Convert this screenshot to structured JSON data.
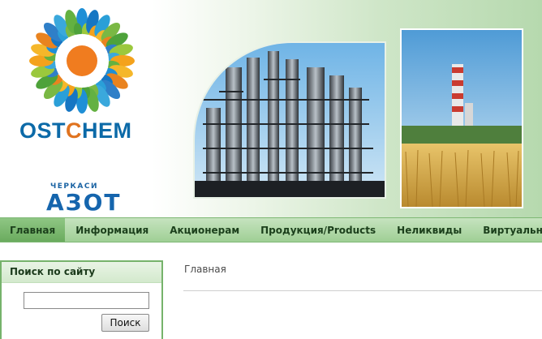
{
  "header": {
    "brand": {
      "prefix": "OST",
      "o": "C",
      "suffix": "HEM"
    },
    "sub_brand": {
      "small": "ЧЕРКАСИ",
      "big": "АЗОТ"
    }
  },
  "nav": {
    "items": [
      {
        "label": "Главная",
        "active": true
      },
      {
        "label": "Информация"
      },
      {
        "label": "Акционерам"
      },
      {
        "label": "Продукция/Products"
      },
      {
        "label": "Неликвиды"
      },
      {
        "label": "Виртуальная п"
      }
    ]
  },
  "search": {
    "title": "Поиск по сайту",
    "input_value": "",
    "button_label": "Поиск"
  },
  "main": {
    "breadcrumb": "Главная"
  }
}
